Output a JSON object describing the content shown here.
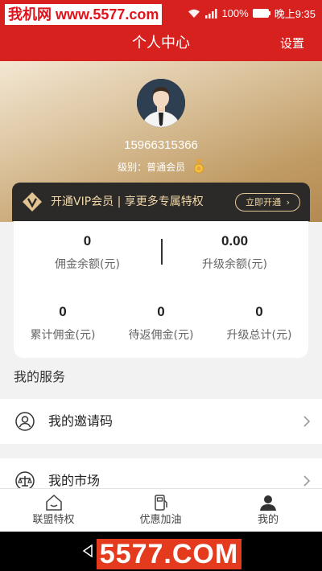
{
  "watermark": {
    "top_text": "我机网 www.5577.com",
    "bottom_text": "5577.COM"
  },
  "status_bar": {
    "battery": "100%",
    "time": "晚上9:35"
  },
  "header": {
    "title": "个人中心",
    "settings_label": "设置"
  },
  "profile": {
    "phone": "15966315366",
    "level_text": "级别：普通会员"
  },
  "vip_banner": {
    "text": "开通VIP会员 | 享更多专属特权",
    "button_label": "立即开通"
  },
  "stats": {
    "commission_balance": {
      "value": "0",
      "label": "佣金余额(元)"
    },
    "upgrade_balance": {
      "value": "0.00",
      "label": "升级余额(元)"
    },
    "total_commission": {
      "value": "0",
      "label": "累计佣金(元)"
    },
    "pending_commission": {
      "value": "0",
      "label": "待返佣金(元)"
    },
    "upgrade_total": {
      "value": "0",
      "label": "升级总计(元)"
    }
  },
  "services": {
    "title": "我的服务",
    "items": [
      {
        "label": "我的邀请码",
        "icon": "user-circle-icon"
      },
      {
        "label": "我的市场",
        "icon": "scale-icon"
      }
    ]
  },
  "tabbar": [
    {
      "label": "联盟特权",
      "icon": "home-icon",
      "active": false
    },
    {
      "label": "优惠加油",
      "icon": "fuel-icon",
      "active": false
    },
    {
      "label": "我的",
      "icon": "person-icon",
      "active": true
    }
  ],
  "colors": {
    "primary_red": "#d6211f",
    "gold": "#c09b64",
    "vip_dark": "#2c2a28",
    "vip_text": "#f0d7a9"
  }
}
